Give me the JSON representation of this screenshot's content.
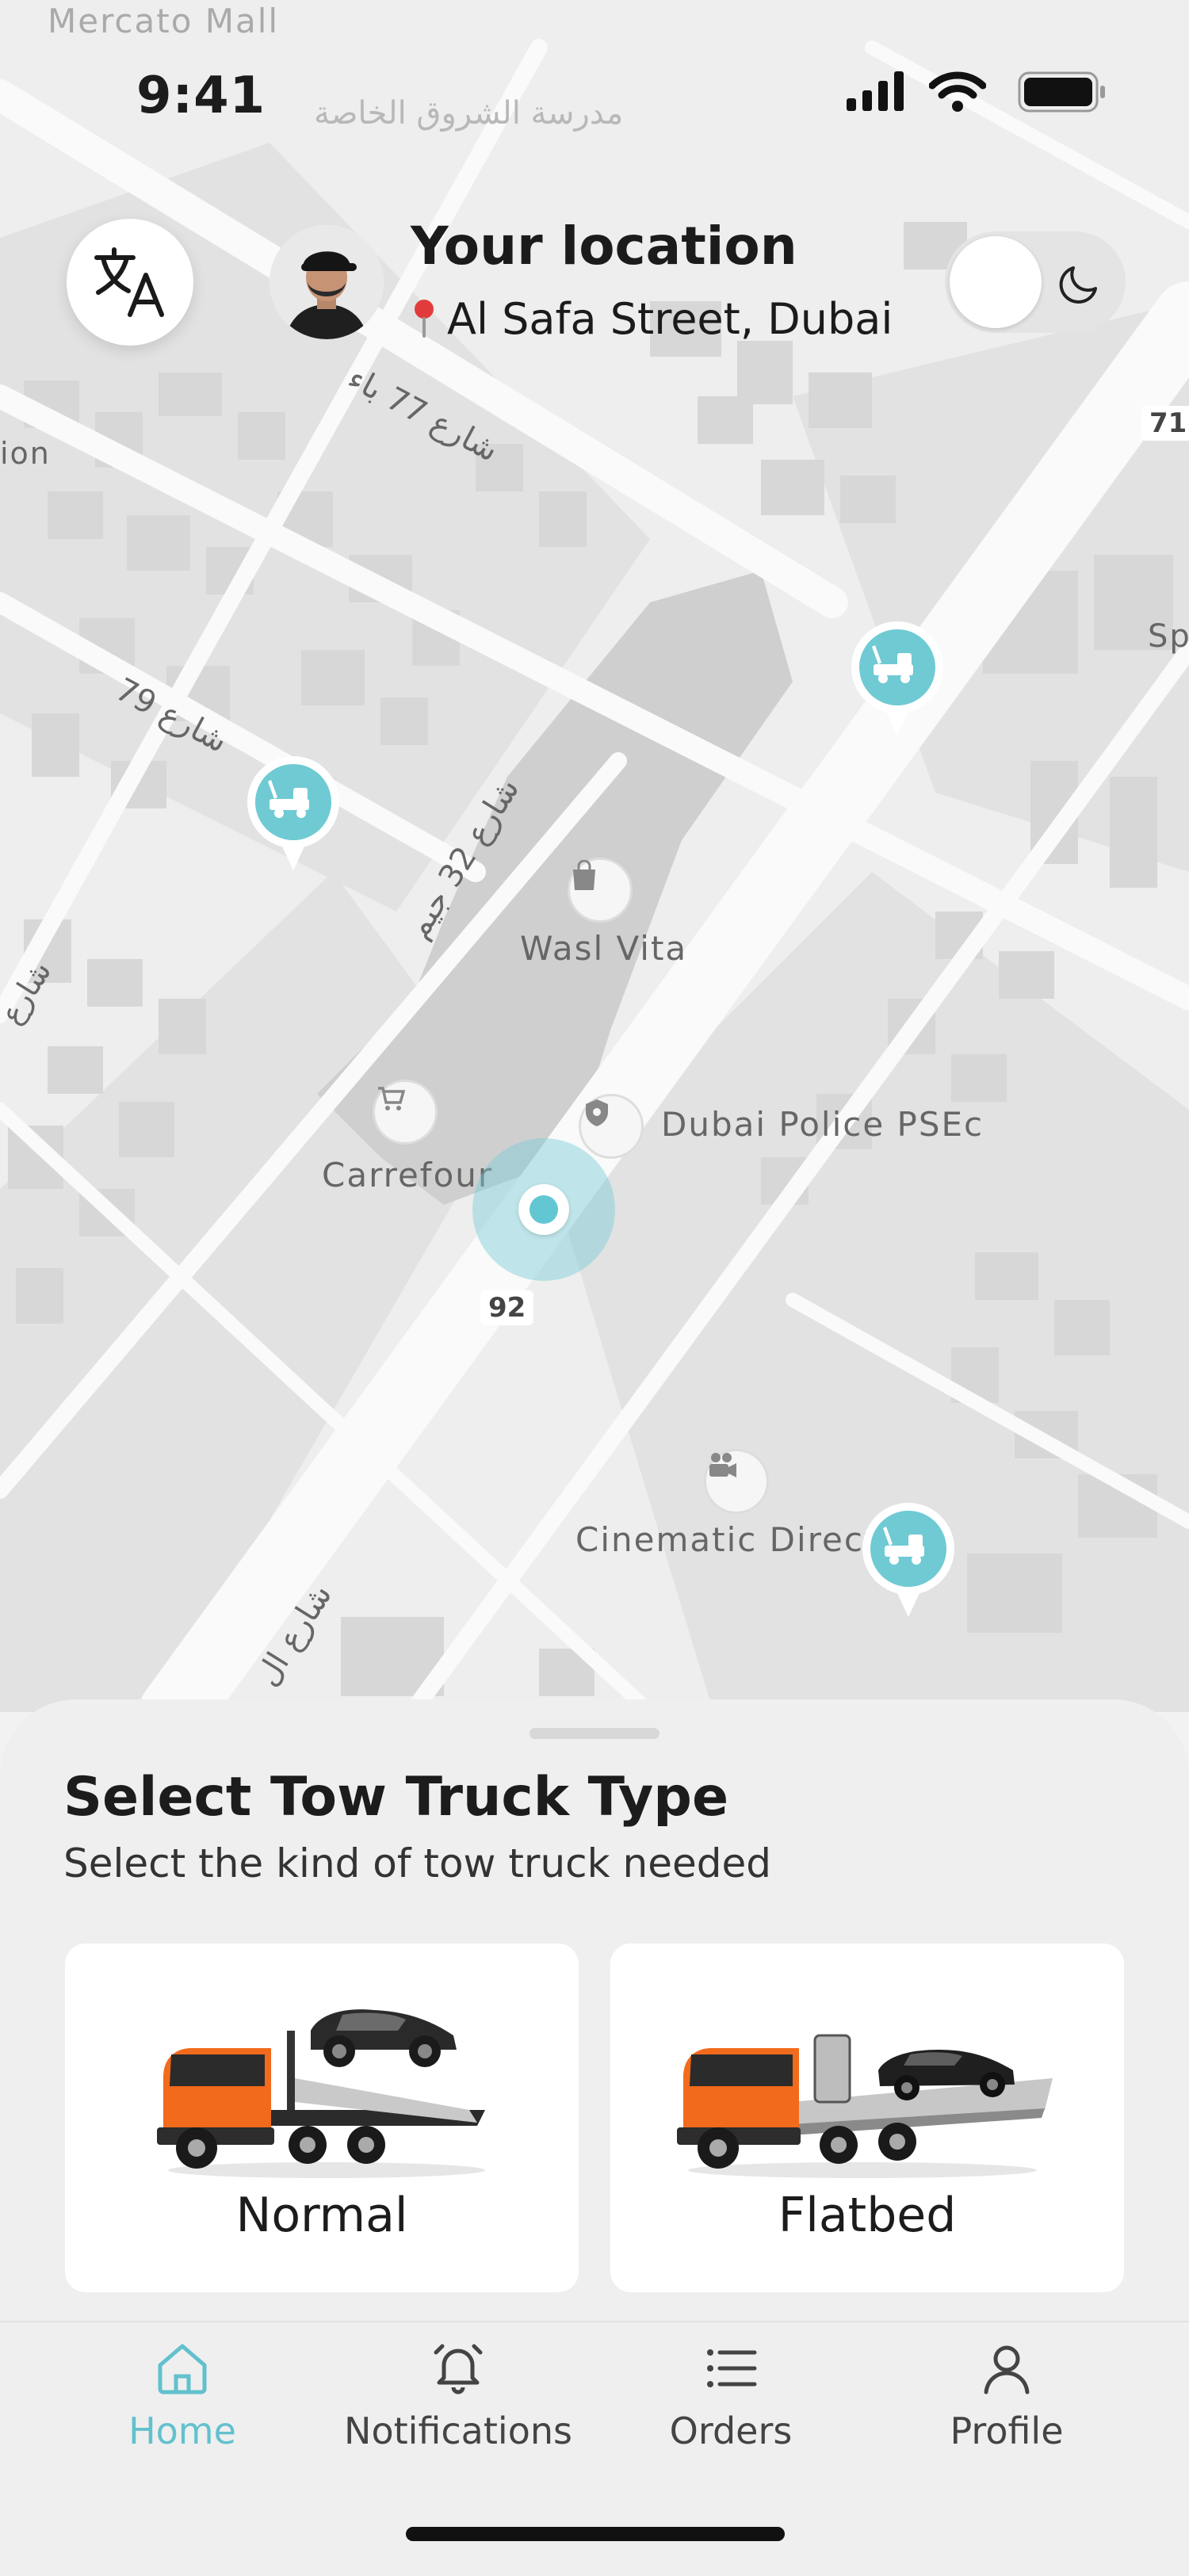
{
  "status_bar": {
    "time": "9:41"
  },
  "header": {
    "location_title": "Your location",
    "location_address": "Al Safa Street, Dubai"
  },
  "map": {
    "labels": {
      "top_mall": "Mercato Mall",
      "school": "مدرسة الشروق الخاصة",
      "wasl_vita": "Wasl Vita",
      "police": "Dubai Police PSEc",
      "carrefour": "Carrefour",
      "cinematic": "Cinematic Direct",
      "sp": "Sp",
      "ion": "ion",
      "street77": "شارع 77 باء",
      "street79": "شارع 79",
      "street32": "شارع 32 جيم",
      "street_bottom": "شارع ال",
      "street_left": "شارع"
    },
    "road_badges": {
      "b92": "92",
      "b71": "71"
    }
  },
  "sheet": {
    "title": "Select Tow Truck Type",
    "subtitle": "Select the kind of tow truck needed",
    "options": [
      {
        "label": "Normal"
      },
      {
        "label": "Flatbed"
      }
    ]
  },
  "tabbar": {
    "items": [
      {
        "label": "Home",
        "icon": "home-icon",
        "active": true
      },
      {
        "label": "Notifications",
        "icon": "bell-icon"
      },
      {
        "label": "Orders",
        "icon": "list-icon"
      },
      {
        "label": "Profile",
        "icon": "user-icon"
      }
    ]
  },
  "colors": {
    "accent": "#62c1cd",
    "truck_orange": "#f26a1b"
  }
}
